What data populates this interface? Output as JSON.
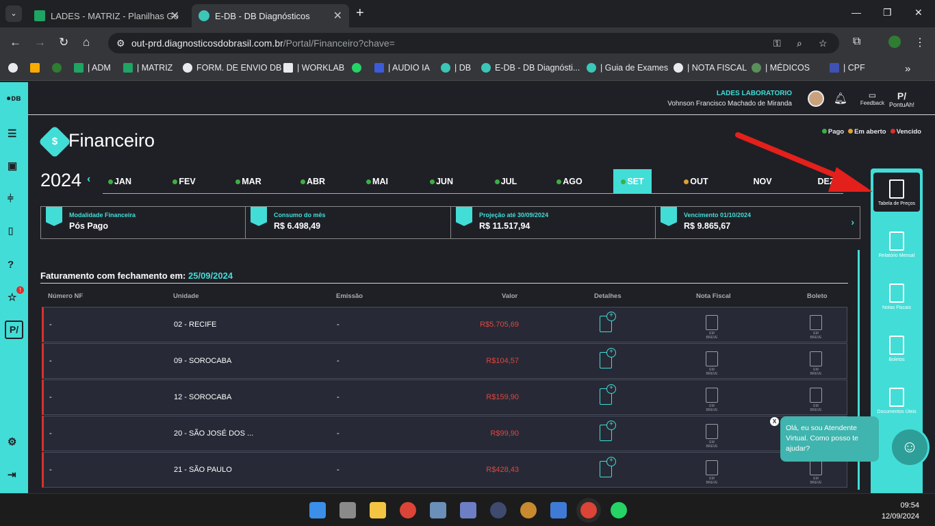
{
  "browser": {
    "tabs": [
      {
        "label": "LADES - MATRIZ - Planilhas Go"
      },
      {
        "label": "E-DB - DB Diagnósticos"
      }
    ],
    "url_host": "out-prd.diagnosticosdobrasil.com.br",
    "url_path": "/Portal/Financeiro?chave=",
    "bookmarks": [
      {
        "label": "| ADM"
      },
      {
        "label": "| MATRIZ"
      },
      {
        "label": "FORM. DE ENVIO DB"
      },
      {
        "label": "| WORKLAB"
      },
      {
        "label": "| AUDIO IA"
      },
      {
        "label": "| DB"
      },
      {
        "label": "E-DB - DB Diagnósti..."
      },
      {
        "label": "| Guia de Exames"
      },
      {
        "label": "| NOTA FISCAL"
      },
      {
        "label": "| MÉDICOS"
      },
      {
        "label": "| CPF"
      }
    ]
  },
  "header": {
    "lab": "LADES LABORATORIO",
    "user": "Vohnson Francisco Machado de Miranda",
    "feedback": "Feedback",
    "pontuah": "PontuAh!",
    "badge_count": "!"
  },
  "legend": {
    "pago": "Pago",
    "aberto": "Em aberto",
    "vencido": "Vencido"
  },
  "colors": {
    "accent": "#42ddd7",
    "pago": "#3cb043",
    "aberto": "#e0a030",
    "vencido": "#d9302c"
  },
  "page_title": "Financeiro",
  "title_icon": "$",
  "year": "2024",
  "months": [
    {
      "label": "JAN",
      "status": "pago"
    },
    {
      "label": "FEV",
      "status": "pago"
    },
    {
      "label": "MAR",
      "status": "pago"
    },
    {
      "label": "ABR",
      "status": "pago"
    },
    {
      "label": "MAI",
      "status": "pago"
    },
    {
      "label": "JUN",
      "status": "pago"
    },
    {
      "label": "JUL",
      "status": "pago"
    },
    {
      "label": "AGO",
      "status": "pago"
    },
    {
      "label": "SET",
      "status": "pago",
      "selected": true
    },
    {
      "label": "OUT",
      "status": "aberto"
    },
    {
      "label": "NOV",
      "status": ""
    },
    {
      "label": "DEZ",
      "status": ""
    }
  ],
  "cards": [
    {
      "label": "Modalidade Financeira",
      "value": "Pós Pago"
    },
    {
      "label": "Consumo do mês",
      "value": "R$ 6.498,49"
    },
    {
      "label": "Projeção até 30/09/2024",
      "value": "R$ 11.517,94"
    },
    {
      "label": "Vencimento 01/10/2024",
      "value": "R$ 9.865,67"
    }
  ],
  "billing": {
    "title": "Faturamento com fechamento em:",
    "date": "25/09/2024",
    "columns": [
      "Número NF",
      "Unidade",
      "Emissão",
      "Valor",
      "Detalhes",
      "Nota Fiscal",
      "Boleto"
    ],
    "soon_label": "EM BREVE",
    "rows": [
      {
        "nf": "-",
        "unidade": "02 - RECIFE",
        "emissao": "-",
        "valor": "R$5.705,69"
      },
      {
        "nf": "-",
        "unidade": "09 - SOROCABA",
        "emissao": "-",
        "valor": "R$104,57"
      },
      {
        "nf": "-",
        "unidade": "12 - SOROCABA",
        "emissao": "-",
        "valor": "R$159,90"
      },
      {
        "nf": "-",
        "unidade": "20 - SÃO JOSÉ DOS ...",
        "emissao": "-",
        "valor": "R$99,90"
      },
      {
        "nf": "-",
        "unidade": "21 - SÃO PAULO",
        "emissao": "-",
        "valor": "R$428,43"
      }
    ]
  },
  "right_panel": [
    {
      "label": "Tabela de Preços",
      "selected": true
    },
    {
      "label": "Relatório Mensal"
    },
    {
      "label": "Notas Fiscais"
    },
    {
      "label": "Boletos"
    },
    {
      "label": "Documentos Úteis"
    }
  ],
  "chat": {
    "message": "Olá, eu sou Atendente Virtual. Como posso te ajudar?",
    "close": "X"
  },
  "clock": {
    "time": "09:54",
    "date": "12/09/2024"
  }
}
